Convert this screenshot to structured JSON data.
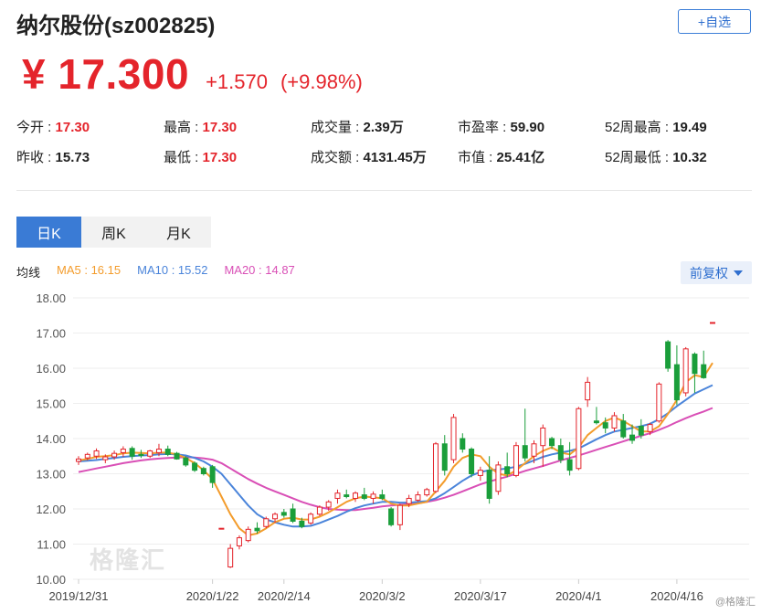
{
  "header": {
    "title": "纳尔股份(sz002825)",
    "follow_label": "+自选",
    "price": "¥ 17.300",
    "change": "+1.570",
    "change_pct": "(+9.98%)"
  },
  "stats": [
    {
      "label": "今开",
      "value": "17.30",
      "color": "red"
    },
    {
      "label": "最高",
      "value": "17.30",
      "color": "red"
    },
    {
      "label": "成交量",
      "value": "2.39万",
      "color": "dark"
    },
    {
      "label": "市盈率",
      "value": "59.90",
      "color": "dark"
    },
    {
      "label": "52周最高",
      "value": "19.49",
      "color": "dark"
    },
    {
      "label": "昨收",
      "value": "15.73",
      "color": "dark"
    },
    {
      "label": "最低",
      "value": "17.30",
      "color": "red"
    },
    {
      "label": "成交额",
      "value": "4131.45万",
      "color": "dark"
    },
    {
      "label": "市值",
      "value": "25.41亿",
      "color": "dark"
    },
    {
      "label": "52周最低",
      "value": "10.32",
      "color": "dark"
    }
  ],
  "tabs": [
    {
      "label": "日K",
      "active": true
    },
    {
      "label": "周K",
      "active": false
    },
    {
      "label": "月K",
      "active": false
    }
  ],
  "legend": {
    "label": "均线",
    "ma5": "MA5 : 16.15",
    "ma10": "MA10 : 15.52",
    "ma20": "MA20 : 14.87"
  },
  "adjust_label": "前复权",
  "watermark": "格隆汇",
  "corner_mark": "@格隆汇",
  "colors": {
    "up": "#e4242b",
    "down": "#1a9e3a",
    "ma5": "#f39c2c",
    "ma10": "#4a84da",
    "ma20": "#d94fb6",
    "accent": "#3a7bd5"
  },
  "chart_data": {
    "type": "candlestick",
    "ylim": [
      10.0,
      18.0
    ],
    "yticks": [
      "18.00",
      "17.00",
      "16.00",
      "15.00",
      "14.00",
      "13.00",
      "12.00",
      "11.00",
      "10.00"
    ],
    "xticks": [
      {
        "label": "2019/12/31",
        "index": 0
      },
      {
        "label": "2020/1/22",
        "index": 15
      },
      {
        "label": "2020/2/14",
        "index": 23
      },
      {
        "label": "2020/3/2",
        "index": 34
      },
      {
        "label": "2020/3/17",
        "index": 45
      },
      {
        "label": "2020/4/1",
        "index": 56
      },
      {
        "label": "2020/4/16",
        "index": 67
      }
    ],
    "candles": [
      {
        "o": 13.35,
        "h": 13.5,
        "l": 13.25,
        "c": 13.42
      },
      {
        "o": 13.45,
        "h": 13.6,
        "l": 13.38,
        "c": 13.55
      },
      {
        "o": 13.5,
        "h": 13.72,
        "l": 13.42,
        "c": 13.65
      },
      {
        "o": 13.4,
        "h": 13.55,
        "l": 13.3,
        "c": 13.48
      },
      {
        "o": 13.48,
        "h": 13.66,
        "l": 13.4,
        "c": 13.58
      },
      {
        "o": 13.6,
        "h": 13.78,
        "l": 13.48,
        "c": 13.7
      },
      {
        "o": 13.72,
        "h": 13.78,
        "l": 13.4,
        "c": 13.5
      },
      {
        "o": 13.55,
        "h": 13.68,
        "l": 13.45,
        "c": 13.52
      },
      {
        "o": 13.5,
        "h": 13.68,
        "l": 13.45,
        "c": 13.65
      },
      {
        "o": 13.6,
        "h": 13.85,
        "l": 13.5,
        "c": 13.7
      },
      {
        "o": 13.7,
        "h": 13.8,
        "l": 13.5,
        "c": 13.55
      },
      {
        "o": 13.58,
        "h": 13.62,
        "l": 13.4,
        "c": 13.42
      },
      {
        "o": 13.45,
        "h": 13.5,
        "l": 13.2,
        "c": 13.25
      },
      {
        "o": 13.3,
        "h": 13.35,
        "l": 13.05,
        "c": 13.1
      },
      {
        "o": 13.15,
        "h": 13.2,
        "l": 12.95,
        "c": 13.0
      },
      {
        "o": 13.2,
        "h": 13.25,
        "l": 12.6,
        "c": 12.75
      },
      {
        "o": 11.45,
        "h": 11.45,
        "l": 11.45,
        "c": 11.45
      },
      {
        "o": 10.35,
        "h": 11.0,
        "l": 10.32,
        "c": 10.88
      },
      {
        "o": 10.95,
        "h": 11.25,
        "l": 10.85,
        "c": 11.18
      },
      {
        "o": 11.1,
        "h": 11.5,
        "l": 11.05,
        "c": 11.42
      },
      {
        "o": 11.45,
        "h": 11.62,
        "l": 11.3,
        "c": 11.38
      },
      {
        "o": 11.5,
        "h": 11.78,
        "l": 11.45,
        "c": 11.72
      },
      {
        "o": 11.72,
        "h": 11.9,
        "l": 11.6,
        "c": 11.85
      },
      {
        "o": 11.9,
        "h": 12.0,
        "l": 11.75,
        "c": 11.82
      },
      {
        "o": 12.0,
        "h": 12.15,
        "l": 11.6,
        "c": 11.65
      },
      {
        "o": 11.65,
        "h": 11.75,
        "l": 11.45,
        "c": 11.5
      },
      {
        "o": 11.6,
        "h": 11.9,
        "l": 11.55,
        "c": 11.85
      },
      {
        "o": 11.85,
        "h": 12.1,
        "l": 11.8,
        "c": 12.05
      },
      {
        "o": 12.05,
        "h": 12.25,
        "l": 11.95,
        "c": 12.2
      },
      {
        "o": 12.3,
        "h": 12.55,
        "l": 12.15,
        "c": 12.45
      },
      {
        "o": 12.4,
        "h": 12.55,
        "l": 12.3,
        "c": 12.35
      },
      {
        "o": 12.3,
        "h": 12.5,
        "l": 12.2,
        "c": 12.45
      },
      {
        "o": 12.4,
        "h": 12.6,
        "l": 12.25,
        "c": 12.3
      },
      {
        "o": 12.3,
        "h": 12.5,
        "l": 12.15,
        "c": 12.42
      },
      {
        "o": 12.4,
        "h": 12.55,
        "l": 12.25,
        "c": 12.3
      },
      {
        "o": 12.0,
        "h": 12.05,
        "l": 11.5,
        "c": 11.55
      },
      {
        "o": 11.55,
        "h": 12.15,
        "l": 11.4,
        "c": 12.1
      },
      {
        "o": 12.15,
        "h": 12.4,
        "l": 12.05,
        "c": 12.3
      },
      {
        "o": 12.25,
        "h": 12.5,
        "l": 12.2,
        "c": 12.4
      },
      {
        "o": 12.4,
        "h": 12.6,
        "l": 12.35,
        "c": 12.55
      },
      {
        "o": 12.5,
        "h": 13.9,
        "l": 12.45,
        "c": 13.85
      },
      {
        "o": 13.85,
        "h": 14.1,
        "l": 12.95,
        "c": 13.1
      },
      {
        "o": 13.4,
        "h": 14.7,
        "l": 13.3,
        "c": 14.6
      },
      {
        "o": 14.0,
        "h": 14.15,
        "l": 13.6,
        "c": 13.7
      },
      {
        "o": 13.7,
        "h": 13.75,
        "l": 12.9,
        "c": 13.0
      },
      {
        "o": 12.95,
        "h": 13.2,
        "l": 12.8,
        "c": 13.1
      },
      {
        "o": 13.1,
        "h": 13.5,
        "l": 12.15,
        "c": 12.3
      },
      {
        "o": 12.5,
        "h": 13.35,
        "l": 12.4,
        "c": 13.25
      },
      {
        "o": 13.2,
        "h": 13.6,
        "l": 12.9,
        "c": 13.0
      },
      {
        "o": 12.95,
        "h": 13.9,
        "l": 12.9,
        "c": 13.8
      },
      {
        "o": 13.8,
        "h": 14.85,
        "l": 13.35,
        "c": 13.45
      },
      {
        "o": 13.5,
        "h": 13.95,
        "l": 13.3,
        "c": 13.85
      },
      {
        "o": 13.8,
        "h": 14.4,
        "l": 13.2,
        "c": 14.3
      },
      {
        "o": 14.0,
        "h": 14.05,
        "l": 13.7,
        "c": 13.8
      },
      {
        "o": 13.8,
        "h": 14.0,
        "l": 13.3,
        "c": 13.4
      },
      {
        "o": 13.4,
        "h": 13.9,
        "l": 12.95,
        "c": 13.1
      },
      {
        "o": 13.15,
        "h": 14.9,
        "l": 13.1,
        "c": 14.85
      },
      {
        "o": 15.1,
        "h": 15.75,
        "l": 14.9,
        "c": 15.6
      },
      {
        "o": 14.5,
        "h": 14.9,
        "l": 14.4,
        "c": 14.45
      },
      {
        "o": 14.45,
        "h": 14.6,
        "l": 14.15,
        "c": 14.3
      },
      {
        "o": 14.3,
        "h": 14.75,
        "l": 14.2,
        "c": 14.65
      },
      {
        "o": 14.5,
        "h": 14.7,
        "l": 14.0,
        "c": 14.05
      },
      {
        "o": 14.1,
        "h": 14.4,
        "l": 13.85,
        "c": 13.95
      },
      {
        "o": 14.35,
        "h": 14.55,
        "l": 14.0,
        "c": 14.1
      },
      {
        "o": 14.2,
        "h": 14.45,
        "l": 14.1,
        "c": 14.4
      },
      {
        "o": 14.5,
        "h": 15.6,
        "l": 14.45,
        "c": 15.55
      },
      {
        "o": 16.75,
        "h": 16.8,
        "l": 15.9,
        "c": 16.0
      },
      {
        "o": 16.1,
        "h": 16.65,
        "l": 14.95,
        "c": 15.1
      },
      {
        "o": 15.3,
        "h": 16.6,
        "l": 15.2,
        "c": 16.55
      },
      {
        "o": 16.4,
        "h": 16.45,
        "l": 15.3,
        "c": 15.85
      },
      {
        "o": 16.1,
        "h": 16.5,
        "l": 15.7,
        "c": 15.73
      },
      {
        "o": 17.3,
        "h": 17.3,
        "l": 17.3,
        "c": 17.3
      }
    ],
    "ma5": [
      13.38,
      13.42,
      13.48,
      13.5,
      13.53,
      13.58,
      13.6,
      13.59,
      13.58,
      13.6,
      13.6,
      13.55,
      13.45,
      13.3,
      13.1,
      12.85,
      12.35,
      11.85,
      11.45,
      11.25,
      11.3,
      11.45,
      11.62,
      11.72,
      11.75,
      11.7,
      11.7,
      11.78,
      11.9,
      12.05,
      12.2,
      12.3,
      12.35,
      12.33,
      12.3,
      12.15,
      12.1,
      12.1,
      12.15,
      12.2,
      12.5,
      12.8,
      13.2,
      13.45,
      13.55,
      13.5,
      13.2,
      13.0,
      12.95,
      13.1,
      13.3,
      13.5,
      13.65,
      13.75,
      13.6,
      13.55,
      13.75,
      14.1,
      14.3,
      14.5,
      14.6,
      14.5,
      14.35,
      14.2,
      14.2,
      14.35,
      14.7,
      15.1,
      15.6,
      15.8,
      15.75,
      16.15
    ],
    "ma10": [
      13.35,
      13.37,
      13.39,
      13.42,
      13.45,
      13.48,
      13.5,
      13.52,
      13.53,
      13.55,
      13.56,
      13.55,
      13.52,
      13.45,
      13.35,
      13.2,
      13.0,
      12.7,
      12.4,
      12.1,
      11.85,
      11.7,
      11.62,
      11.55,
      11.5,
      11.5,
      11.52,
      11.6,
      11.7,
      11.8,
      11.92,
      12.02,
      12.1,
      12.15,
      12.2,
      12.2,
      12.18,
      12.18,
      12.2,
      12.22,
      12.3,
      12.45,
      12.62,
      12.8,
      12.95,
      13.05,
      13.1,
      13.12,
      13.15,
      13.2,
      13.28,
      13.38,
      13.48,
      13.55,
      13.6,
      13.65,
      13.72,
      13.85,
      13.98,
      14.1,
      14.2,
      14.25,
      14.3,
      14.35,
      14.42,
      14.55,
      14.72,
      14.92,
      15.1,
      15.28,
      15.4,
      15.52
    ],
    "ma20": [
      13.05,
      13.1,
      13.15,
      13.2,
      13.25,
      13.3,
      13.34,
      13.38,
      13.41,
      13.43,
      13.45,
      13.46,
      13.47,
      13.46,
      13.44,
      13.4,
      13.3,
      13.15,
      13.0,
      12.85,
      12.72,
      12.6,
      12.5,
      12.4,
      12.3,
      12.2,
      12.12,
      12.05,
      12.0,
      11.98,
      11.97,
      11.97,
      12.0,
      12.03,
      12.07,
      12.1,
      12.12,
      12.14,
      12.16,
      12.2,
      12.25,
      12.32,
      12.4,
      12.5,
      12.6,
      12.7,
      12.78,
      12.85,
      12.92,
      13.0,
      13.08,
      13.15,
      13.22,
      13.3,
      13.38,
      13.45,
      13.52,
      13.6,
      13.68,
      13.76,
      13.84,
      13.92,
      14.0,
      14.08,
      14.15,
      14.25,
      14.35,
      14.47,
      14.58,
      14.68,
      14.77,
      14.87
    ]
  }
}
